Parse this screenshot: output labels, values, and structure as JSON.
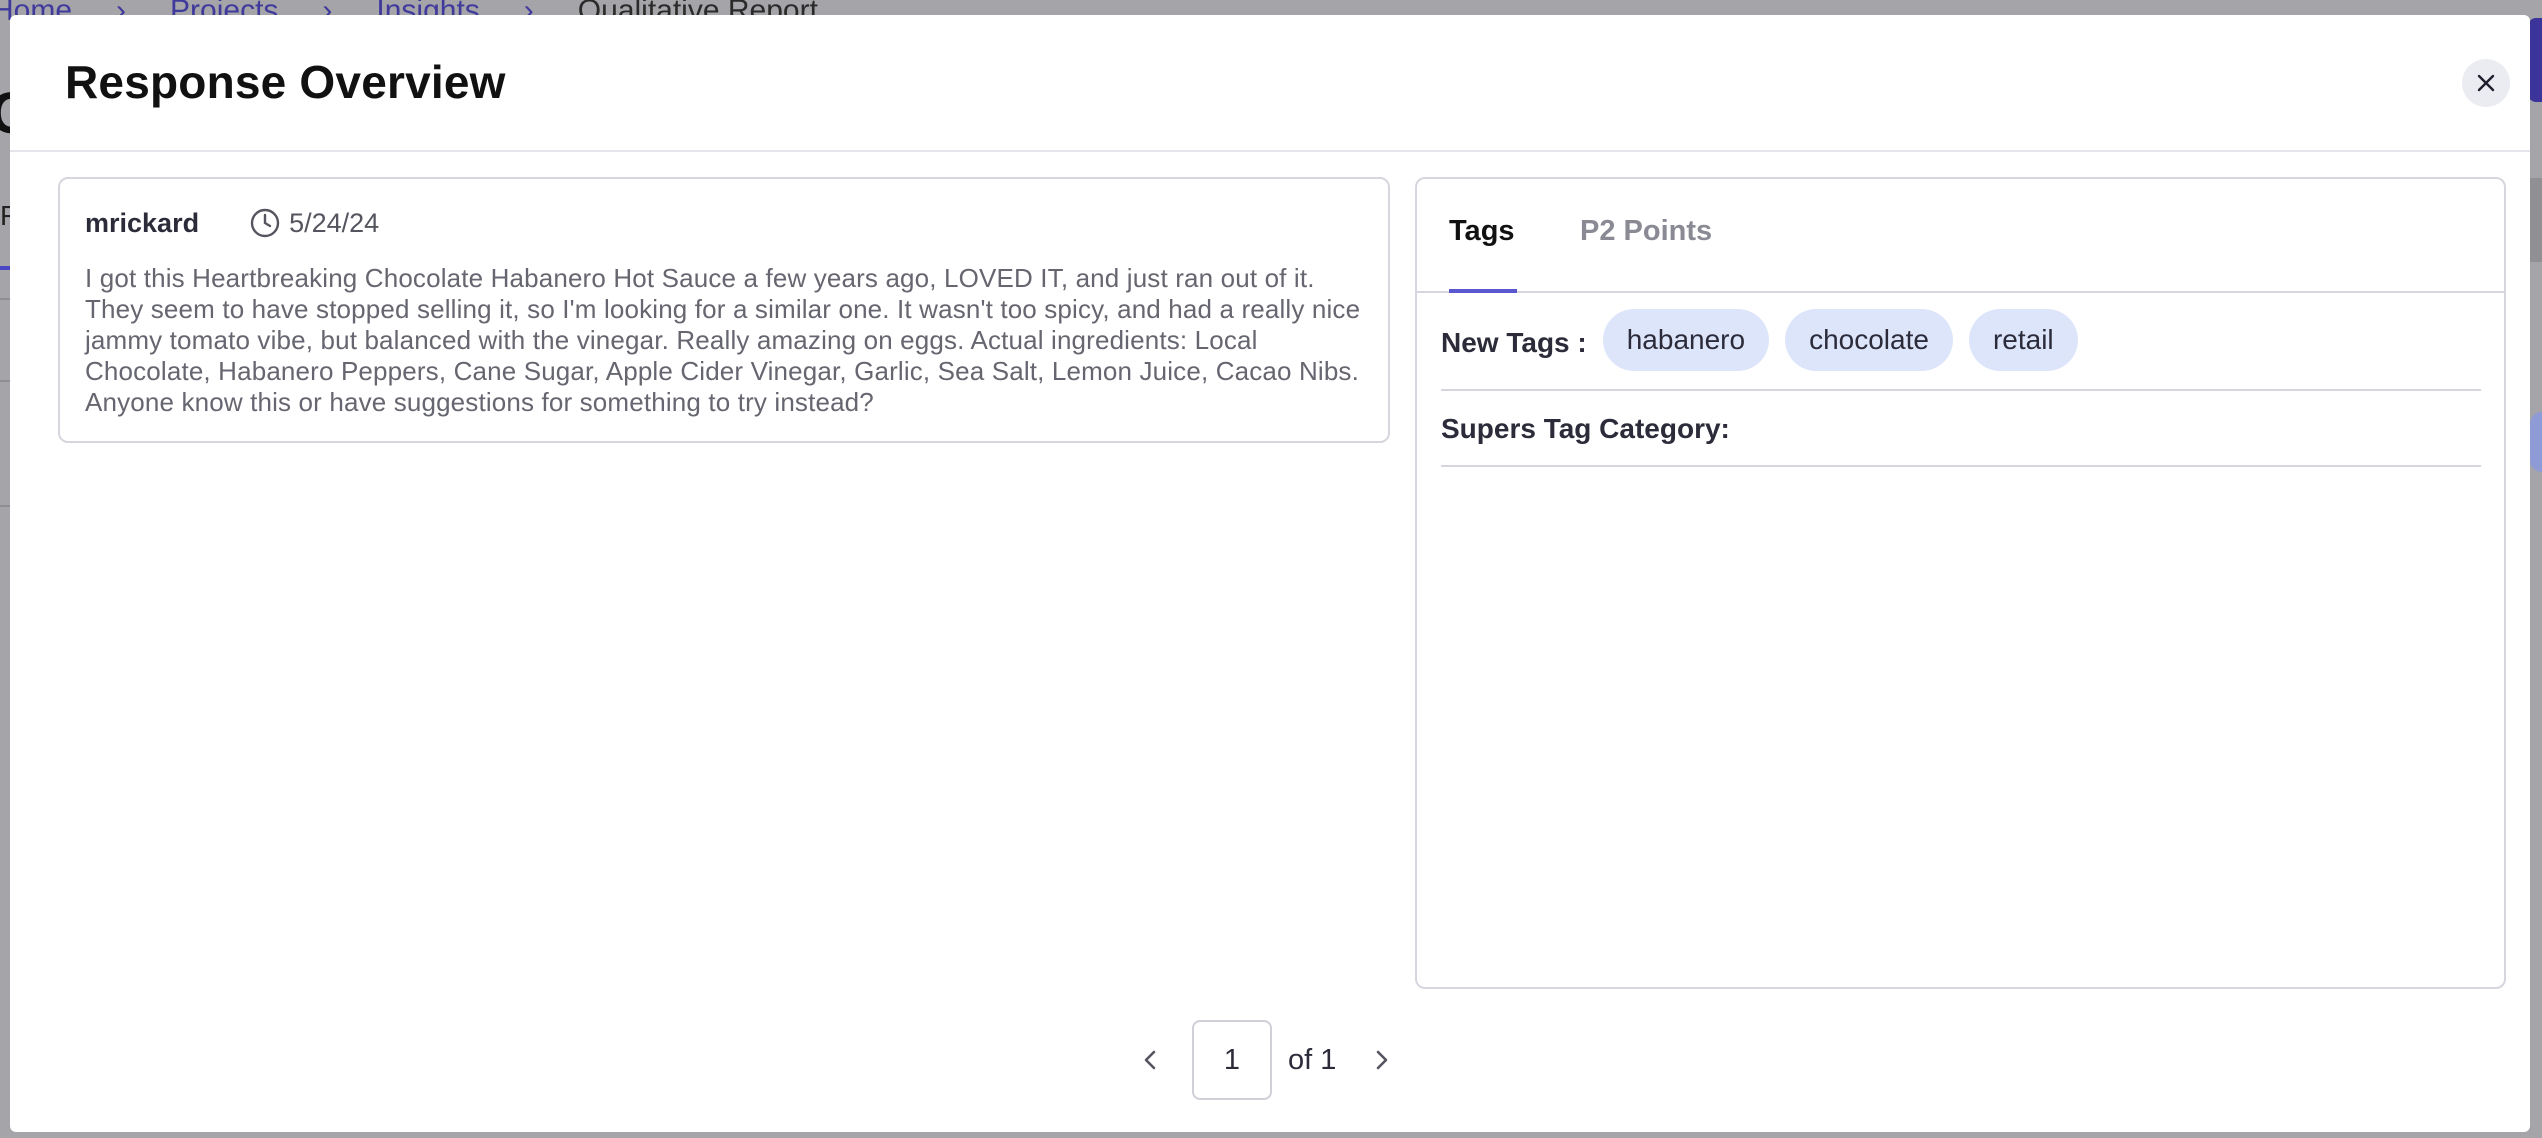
{
  "background": {
    "breadcrumb": [
      "Home",
      "Projects",
      "Insights",
      "Qualitative Report"
    ],
    "title_fragment": "C",
    "tab_fragment": "F"
  },
  "modal": {
    "title": "Response Overview",
    "close_icon": "close-icon"
  },
  "response": {
    "author": "mrickard",
    "date": "5/24/24",
    "date_icon": "clock-icon",
    "text": "I got this Heartbreaking Chocolate Habanero Hot Sauce a few years ago, LOVED IT, and just ran out of it. They seem to have stopped selling it, so I'm looking for a similar one. It wasn't too spicy, and had a really nice jammy tomato vibe, but balanced with the vinegar. Really amazing on eggs. Actual ingredients: Local Chocolate, Habanero Peppers, Cane Sugar, Apple Cider Vinegar, Garlic, Sea Salt, Lemon Juice, Cacao Nibs. Anyone know this or have suggestions for something to try instead?"
  },
  "tabs": [
    {
      "label": "Tags",
      "active": true
    },
    {
      "label": "P2 Points",
      "active": false
    }
  ],
  "tags": {
    "new_tags_label": "New Tags :",
    "new_tags": [
      "habanero",
      "chocolate",
      "retail"
    ],
    "supers_label": "Supers Tag Category:"
  },
  "pagination": {
    "current": "1",
    "total_text": "of 1",
    "prev_icon": "chevron-left-icon",
    "next_icon": "chevron-right-icon"
  },
  "colors": {
    "accent": "#5b57d1",
    "chip_bg": "#dde5fb",
    "overlay": "#a4a4a9",
    "breadcrumb_link": "#3f3a9c"
  }
}
